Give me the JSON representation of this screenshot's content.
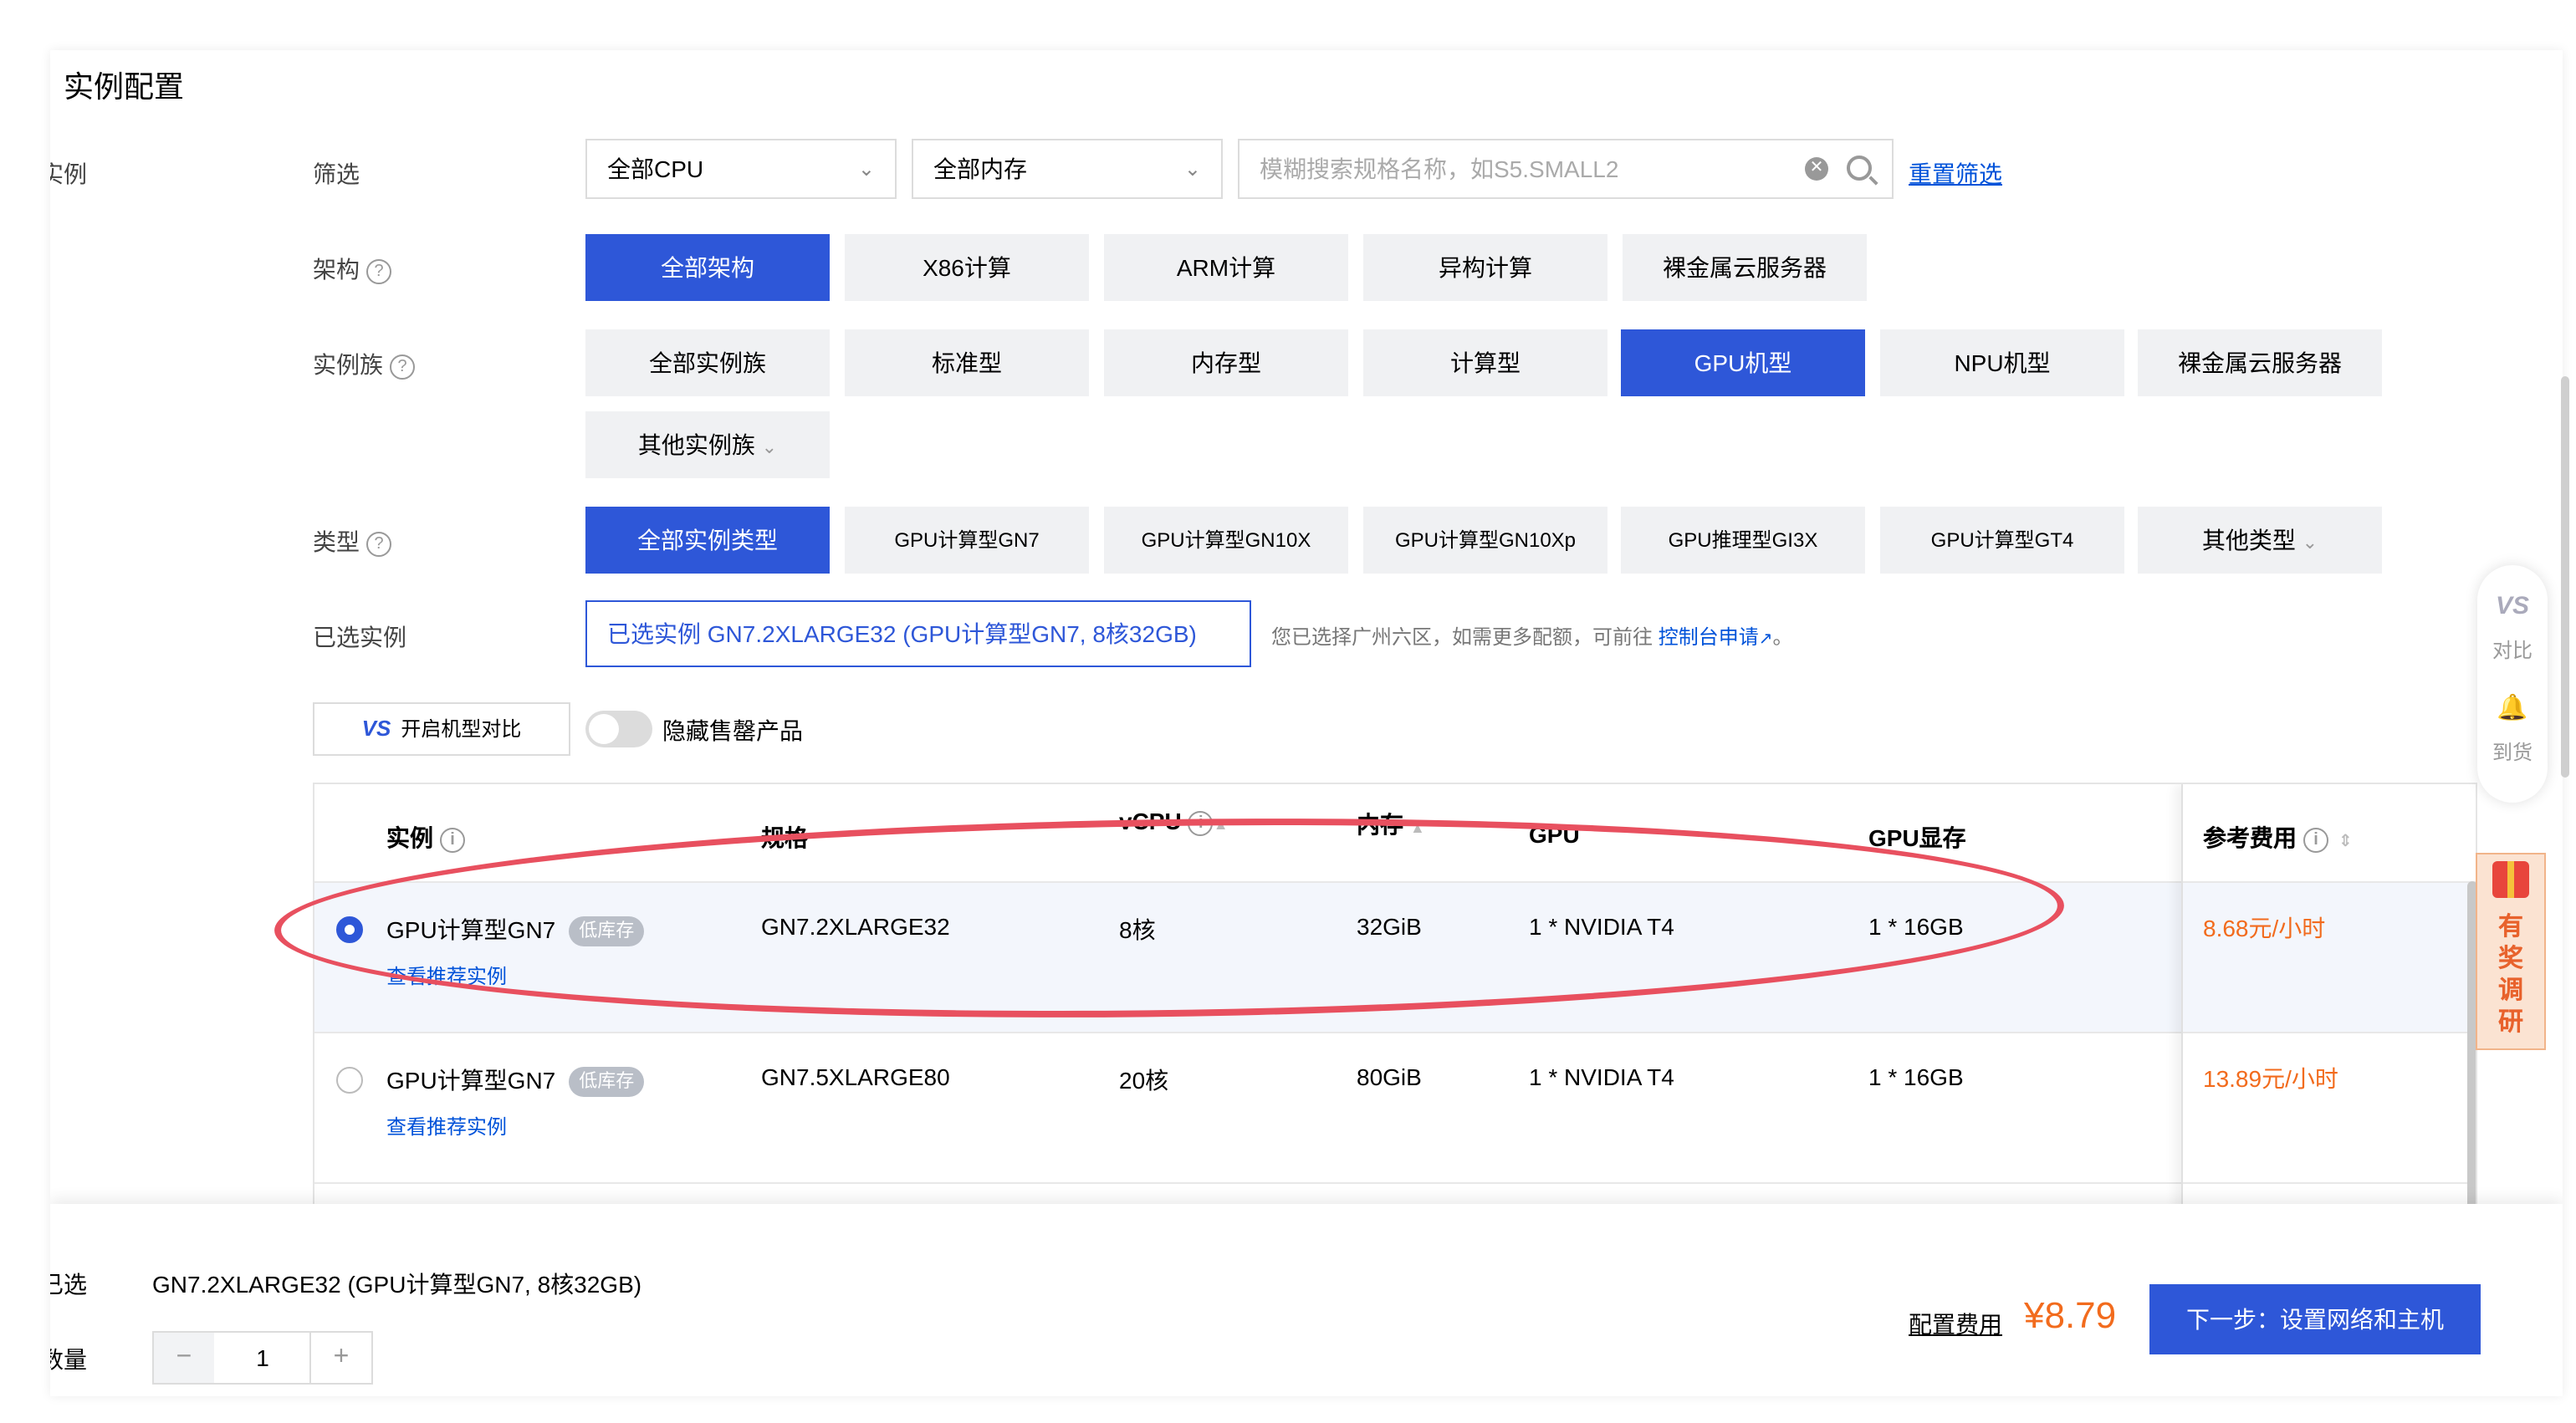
{
  "section_title": "实例配置",
  "left_cut_labels": {
    "instance": "实例",
    "selected": "已选",
    "quantity": "数量"
  },
  "filter": {
    "label": "筛选",
    "cpu_select": "全部CPU",
    "memory_select": "全部内存",
    "search_placeholder": "模糊搜索规格名称，如S5.SMALL2",
    "reset_link": "重置筛选"
  },
  "arch": {
    "label": "架构",
    "options": [
      "全部架构",
      "X86计算",
      "ARM计算",
      "异构计算",
      "裸金属云服务器"
    ],
    "selected_index": 0
  },
  "family": {
    "label": "实例族",
    "options": [
      "全部实例族",
      "标准型",
      "内存型",
      "计算型",
      "GPU机型",
      "NPU机型",
      "裸金属云服务器"
    ],
    "more": "其他实例族",
    "selected_index": 4
  },
  "type": {
    "label": "类型",
    "options": [
      "全部实例类型",
      "GPU计算型GN7",
      "GPU计算型GN10X",
      "GPU计算型GN10Xp",
      "GPU推理型GI3X",
      "GPU计算型GT4"
    ],
    "more": "其他类型",
    "selected_index": 0
  },
  "selected_instance": {
    "label": "已选实例",
    "value": "已选实例  GN7.2XLARGE32 (GPU计算型GN7, 8核32GB)",
    "hint": "您已选择广州六区，如需更多配额，可前往",
    "hint_link": "控制台申请",
    "hint_end": "。"
  },
  "compare_button": {
    "icon": "VS",
    "label": "开启机型对比"
  },
  "hide_soldout": {
    "label": "隐藏售罄产品",
    "on": false
  },
  "table": {
    "headers": {
      "instance": "实例",
      "spec": "规格",
      "vcpu": "vCPU",
      "memory": "内存",
      "gpu": "GPU",
      "gpu_mem": "GPU显存",
      "cost": "参考费用"
    },
    "rows": [
      {
        "name": "GPU计算型GN7",
        "badge": "低库存",
        "link": "查看推荐实例",
        "spec": "GN7.2XLARGE32",
        "vcpu": "8核",
        "memory": "32GiB",
        "gpu": "1 * NVIDIA T4",
        "gpu_mem": "1 * 16GB",
        "price": "8.68元/小时",
        "selected": true
      },
      {
        "name": "GPU计算型GN7",
        "badge": "低库存",
        "link": "查看推荐实例",
        "spec": "GN7.5XLARGE80",
        "vcpu": "20核",
        "memory": "80GiB",
        "gpu": "1 * NVIDIA T4",
        "gpu_mem": "1 * 16GB",
        "price": "13.89元/小时",
        "selected": false
      }
    ]
  },
  "footer": {
    "selected_value": "GN7.2XLARGE32 (GPU计算型GN7, 8核32GB)",
    "quantity": "1",
    "minus": "−",
    "plus": "+",
    "config_fee_label": "配置费用",
    "config_fee_value": "¥8.79",
    "next_button": "下一步：设置网络和主机"
  },
  "side_tools": {
    "compare_icon": "VS",
    "compare_label": "对比",
    "notify_label": "到货"
  },
  "survey": {
    "label": "有奖调研"
  },
  "colors": {
    "primary": "#2e57d8",
    "price": "#f26b1d",
    "annotation": "#e8505f"
  }
}
